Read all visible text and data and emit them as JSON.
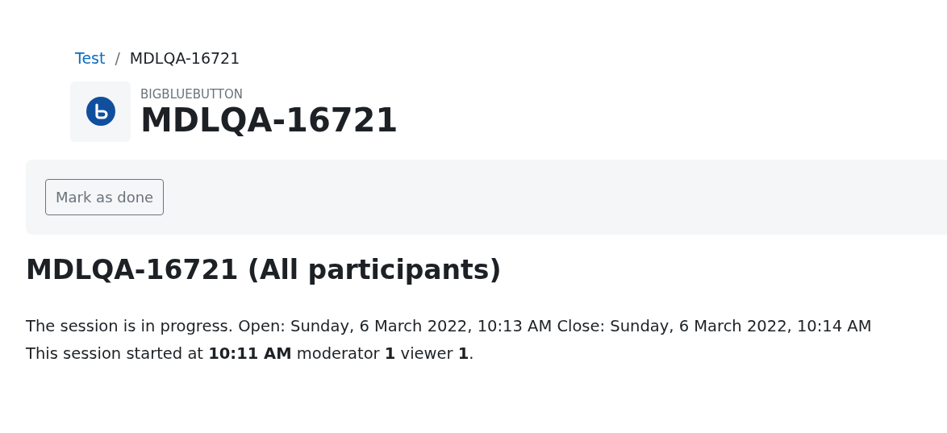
{
  "breadcrumb": [
    {
      "label": "Test",
      "kind": "link"
    },
    {
      "label": "/",
      "kind": "separator"
    },
    {
      "label": "MDLQA-16721",
      "kind": "current"
    }
  ],
  "header": {
    "activity_type": "BIGBLUEBUTTON",
    "title": "MDLQA-16721"
  },
  "completion": {
    "button": "Mark as done"
  },
  "room": {
    "heading": "MDLQA-16721 (All participants)",
    "status": "The session is in progress. Open: Sunday, 6 March 2022, 10:13 AM Close: Sunday, 6 March 2022, 10:14 AM",
    "details": "This session started at **10:11 AM** moderator **1** viewer **1**."
  }
}
